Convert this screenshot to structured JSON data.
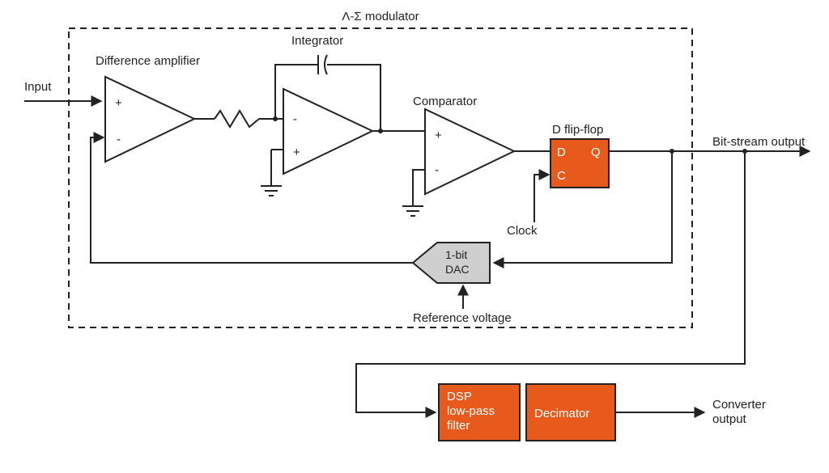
{
  "title": "Λ-Σ modulator",
  "input_label": "Input",
  "blocks": {
    "diff_amp": {
      "label": "Difference amplifier",
      "plus": "+",
      "minus": "-"
    },
    "integrator": {
      "label": "Integrator",
      "plus": "+",
      "minus": "-"
    },
    "comparator": {
      "label": "Comparator",
      "plus": "+",
      "minus": "-"
    },
    "dff": {
      "label": "D flip-flop",
      "d": "D",
      "q": "Q",
      "c": "C"
    },
    "dac": {
      "line1": "1-bit",
      "line2": "DAC"
    },
    "dsp": {
      "line1": "DSP",
      "line2": "low-pass",
      "line3": "filter"
    },
    "decimator": {
      "label": "Decimator"
    }
  },
  "signals": {
    "clock": "Clock",
    "ref_voltage": "Reference voltage",
    "bitstream_out": "Bit-stream output",
    "converter_out1": "Converter",
    "converter_out2": "output"
  },
  "colors": {
    "accent": "#e8591c",
    "dac_fill": "#cfcfcf",
    "stroke": "#222222"
  }
}
